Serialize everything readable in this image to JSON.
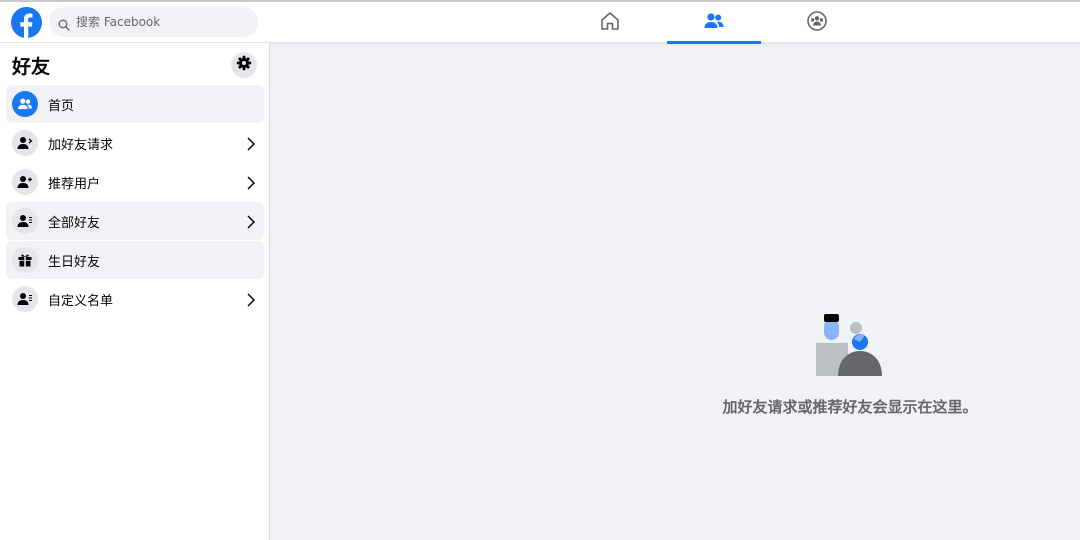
{
  "search": {
    "placeholder": "搜索 Facebook"
  },
  "colors": {
    "brand": "#1877f2",
    "page_bg": "#f0f2f5",
    "text_secondary": "#65676b"
  },
  "top_nav": [
    {
      "name": "home",
      "icon": "home-icon",
      "active": false
    },
    {
      "name": "friends",
      "icon": "friends-icon",
      "active": true
    },
    {
      "name": "groups",
      "icon": "groups-icon",
      "active": false
    }
  ],
  "sidebar": {
    "title": "好友",
    "settings_icon": "gear-icon",
    "items": [
      {
        "label": "首页",
        "icon": "friends-icon",
        "chevron": false
      },
      {
        "label": "加好友请求",
        "icon": "person-add-icon",
        "chevron": true
      },
      {
        "label": "推荐用户",
        "icon": "person-plus-icon",
        "chevron": true
      },
      {
        "label": "全部好友",
        "icon": "person-list-icon",
        "chevron": true
      },
      {
        "label": "生日好友",
        "icon": "gift-icon",
        "chevron": false
      },
      {
        "label": "自定义名单",
        "icon": "person-list-icon",
        "chevron": true
      }
    ]
  },
  "main": {
    "empty_message": "加好友请求或推荐好友会显示在这里。"
  }
}
